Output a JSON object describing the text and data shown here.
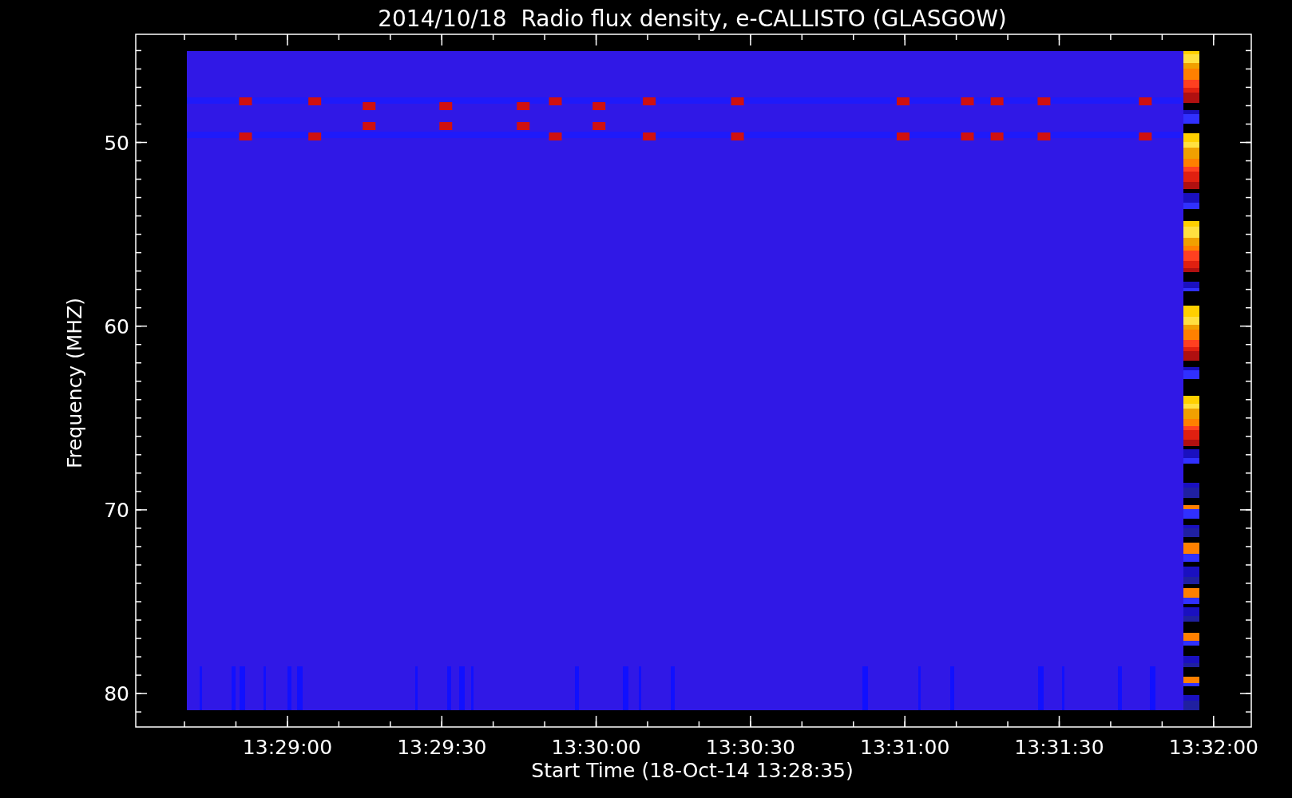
{
  "title": "2014/10/18  Radio flux density, e-CALLISTO (GLASGOW)",
  "y_axis": {
    "label": "Frequency (MHZ)",
    "ticks": [
      "50",
      "60",
      "70",
      "80"
    ]
  },
  "x_axis": {
    "label": "Start Time (18-Oct-14 13:28:35)",
    "ticks": [
      "13:29:00",
      "13:29:30",
      "13:30:00",
      "13:30:30",
      "13:31:00",
      "13:31:30",
      "13:32:00"
    ]
  }
}
